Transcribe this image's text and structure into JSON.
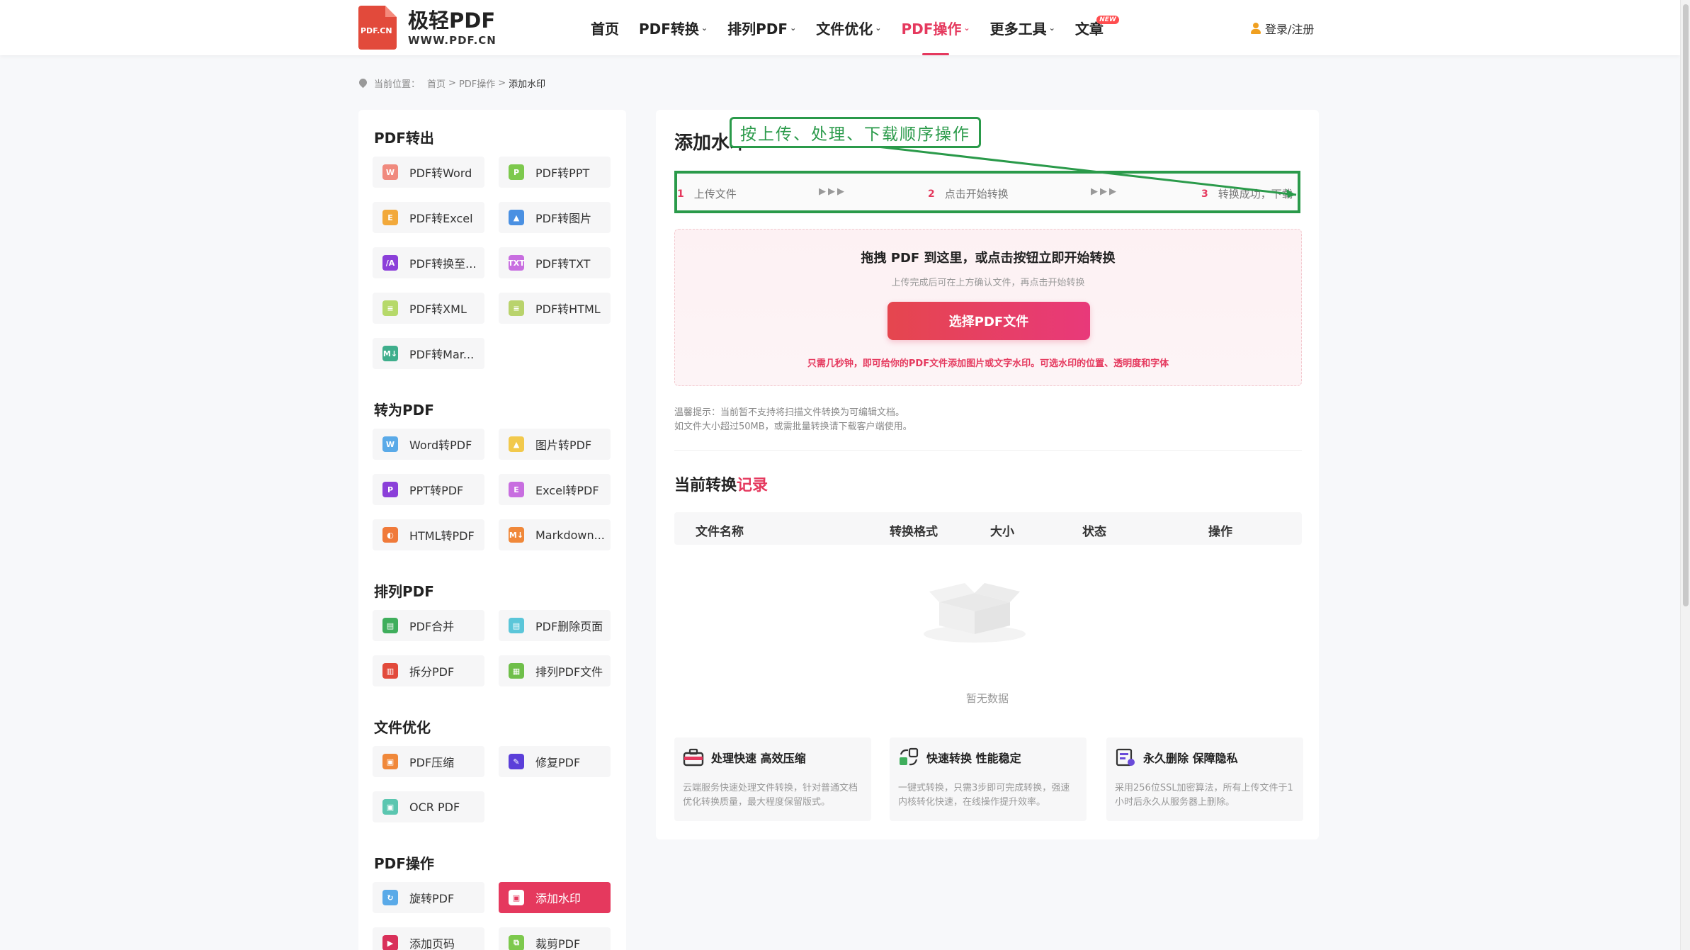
{
  "logo": {
    "title": "极轻PDF",
    "subtitle": "WWW.PDF.CN",
    "badge": "PDF.CN"
  },
  "nav": [
    {
      "label": "首页",
      "caret": false,
      "active": false
    },
    {
      "label": "PDF转换",
      "caret": true,
      "active": false
    },
    {
      "label": "排列PDF",
      "caret": true,
      "active": false
    },
    {
      "label": "文件优化",
      "caret": true,
      "active": false
    },
    {
      "label": "PDF操作",
      "caret": true,
      "active": true
    },
    {
      "label": "更多工具",
      "caret": true,
      "active": false
    },
    {
      "label": "文章",
      "caret": false,
      "active": false,
      "badge": "NEW"
    }
  ],
  "login_label": "登录/注册",
  "breadcrumb": {
    "prefix": "当前位置：",
    "items": [
      "首页",
      "PDF操作",
      "添加水印"
    ],
    "separator": ">"
  },
  "sidebar": {
    "categories": [
      {
        "title": "PDF转出",
        "items": [
          {
            "label": "PDF转Word",
            "icon": "W",
            "color": "#f08a7e"
          },
          {
            "label": "PDF转PPT",
            "icon": "P",
            "color": "#7dc94d"
          },
          {
            "label": "PDF转Excel",
            "icon": "E",
            "color": "#f2a93b"
          },
          {
            "label": "PDF转图片",
            "icon": "▲",
            "color": "#4a90e2"
          },
          {
            "label": "PDF转换至...",
            "icon": "/A",
            "color": "#8b3fd9"
          },
          {
            "label": "PDF转TXT",
            "icon": "TXT",
            "color": "#c86ee0"
          },
          {
            "label": "PDF转XML",
            "icon": "≡",
            "color": "#b6d96a"
          },
          {
            "label": "PDF转HTML",
            "icon": "≡",
            "color": "#b9d36c"
          },
          {
            "label": "PDF转Mar...",
            "icon": "M↓",
            "color": "#3fae8c"
          }
        ]
      },
      {
        "title": "转为PDF",
        "items": [
          {
            "label": "Word转PDF",
            "icon": "W",
            "color": "#5aaae8"
          },
          {
            "label": "图片转PDF",
            "icon": "▲",
            "color": "#f2c94c"
          },
          {
            "label": "PPT转PDF",
            "icon": "P",
            "color": "#8b3fd9"
          },
          {
            "label": "Excel转PDF",
            "icon": "E",
            "color": "#c86ee0"
          },
          {
            "label": "HTML转PDF",
            "icon": "◐",
            "color": "#f07a3a"
          },
          {
            "label": "Markdown...",
            "icon": "M↓",
            "color": "#f0883a"
          }
        ]
      },
      {
        "title": "排列PDF",
        "items": [
          {
            "label": "PDF合并",
            "icon": "▤",
            "color": "#3fae5c"
          },
          {
            "label": "PDF删除页面",
            "icon": "▤",
            "color": "#5bc6d9"
          },
          {
            "label": "拆分PDF",
            "icon": "▥",
            "color": "#e24a3b"
          },
          {
            "label": "排列PDF文件",
            "icon": "▦",
            "color": "#6fbf4a"
          }
        ]
      },
      {
        "title": "文件优化",
        "items": [
          {
            "label": "PDF压缩",
            "icon": "▣",
            "color": "#f0883a"
          },
          {
            "label": "修复PDF",
            "icon": "✎",
            "color": "#5b3fd9"
          },
          {
            "label": "OCR PDF",
            "icon": "▣",
            "color": "#5bc6b0"
          }
        ]
      },
      {
        "title": "PDF操作",
        "items": [
          {
            "label": "旋转PDF",
            "icon": "↻",
            "color": "#5aaae8"
          },
          {
            "label": "添加水印",
            "icon": "▣",
            "color": "#3fae5c",
            "active": true
          },
          {
            "label": "添加页码",
            "icon": "▶",
            "color": "#d9305a"
          },
          {
            "label": "裁剪PDF",
            "icon": "⧉",
            "color": "#7dc94d"
          }
        ]
      }
    ]
  },
  "main": {
    "title": "添加水印",
    "annotation": "按上传、处理、下载顺序操作",
    "steps": [
      {
        "num": "1",
        "label": "上传文件"
      },
      {
        "num": "2",
        "label": "点击开始转换"
      },
      {
        "num": "3",
        "label": "转换成功，下载"
      }
    ],
    "step_arrow": "▶▶▶",
    "upload": {
      "title": "拖拽 PDF 到这里，或点击按钮立即开始转换",
      "hint": "上传完成后可在上方确认文件，再点击开始转换",
      "button": "选择PDF文件",
      "desc": "只需几秒钟，即可给你的PDF文件添加图片或文字水印。可选水印的位置、透明度和字体"
    },
    "tips": [
      "温馨提示：当前暂不支持将扫描文件转换为可编辑文档。",
      "如文件大小超过50MB，或需批量转换请下载客户端使用。"
    ],
    "record_title": {
      "main": "当前转换",
      "accent": "记录"
    },
    "table_headers": [
      "文件名称",
      "转换格式",
      "大小",
      "状态",
      "操作"
    ],
    "empty_text": "暂无数据",
    "features": [
      {
        "title": "处理快速 高效压缩",
        "desc": "云端服务快速处理文件转换，针对普通文档优化转换质量，最大程度保留版式。",
        "icon": "toolbox-icon"
      },
      {
        "title": "快速转换 性能稳定",
        "desc": "一键式转换，只需3步即可完成转换，强速内核转化快速，在线操作提升效率。",
        "icon": "convert-icon"
      },
      {
        "title": "永久删除 保障隐私",
        "desc": "采用256位SSL加密算法，所有上传文件于1小时后永久从服务器上删除。",
        "icon": "shield-icon"
      }
    ]
  },
  "colors": {
    "accent": "#e5395e",
    "annotation": "#2a9a4a"
  }
}
